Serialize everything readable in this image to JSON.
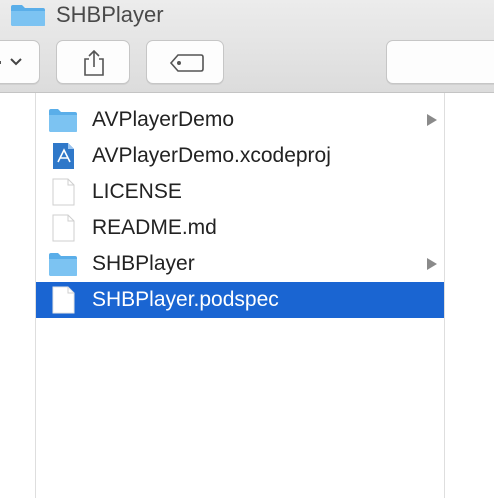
{
  "window": {
    "title": "SHBPlayer"
  },
  "files": [
    {
      "name": "AVPlayerDemo",
      "icon": "folder-icon",
      "has_children": true,
      "selected": false
    },
    {
      "name": "AVPlayerDemo.xcodeproj",
      "icon": "xcode-project-icon",
      "has_children": false,
      "selected": false
    },
    {
      "name": "LICENSE",
      "icon": "document-icon",
      "has_children": false,
      "selected": false
    },
    {
      "name": "README.md",
      "icon": "document-icon",
      "has_children": false,
      "selected": false
    },
    {
      "name": "SHBPlayer",
      "icon": "folder-icon",
      "has_children": true,
      "selected": false
    },
    {
      "name": "SHBPlayer.podspec",
      "icon": "document-icon",
      "has_children": false,
      "selected": true
    }
  ],
  "colors": {
    "selection": "#1a65d2",
    "folder": "#6cb8ee",
    "toolbar": "#e3e3e3"
  }
}
